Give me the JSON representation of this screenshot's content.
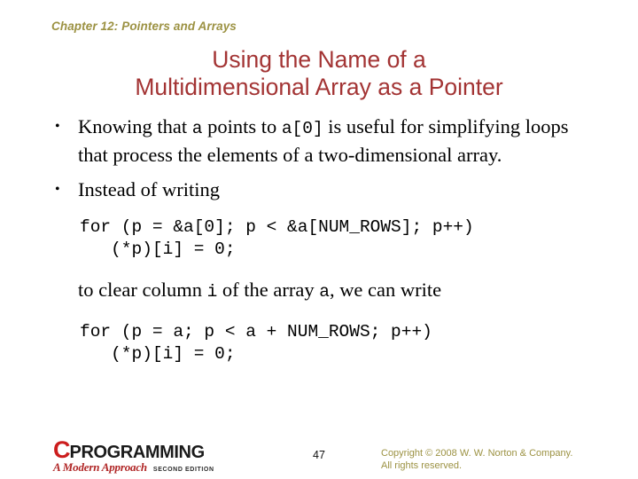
{
  "slide": {
    "chapter_header": "Chapter 12: Pointers and Arrays",
    "title_line_1": "Using the Name of a",
    "title_line_2": "Multidimensional Array as a Pointer",
    "bullet_marker": "•",
    "accent_colors": {
      "title_red": "#a33434",
      "header_olive": "#9c9243",
      "logo_red": "#cc1d1d",
      "body_black": "#000000"
    }
  },
  "body": {
    "bullet_1": {
      "part_1": "Knowing that ",
      "code_1": "a",
      "part_2": " points to ",
      "code_2": "a[0]",
      "part_3": " is useful for simplifying loops that process the elements of a two-dimensional array."
    },
    "bullet_2": {
      "text": "Instead of writing"
    },
    "code_block_1": {
      "line_1": "for (p = &a[0]; p < &a[NUM_ROWS]; p++)",
      "line_2": "   (*p)[i] = 0;"
    },
    "middle_sentence": {
      "part_1": "to clear column ",
      "code_1": "i",
      "part_2": " of the array ",
      "code_2": "a",
      "part_3": ", we can write"
    },
    "code_block_2": {
      "line_1": "for (p = a; p < a + NUM_ROWS; p++)",
      "line_2": "   (*p)[i] = 0;"
    }
  },
  "footer": {
    "logo_c": "C",
    "logo_word": "PROGRAMMING",
    "logo_subtitle": "A Modern Approach",
    "logo_edition": "Second Edition",
    "page_number": "47",
    "copyright_line_1": "Copyright © 2008 W. W. Norton & Company.",
    "copyright_line_2": "All rights reserved."
  }
}
